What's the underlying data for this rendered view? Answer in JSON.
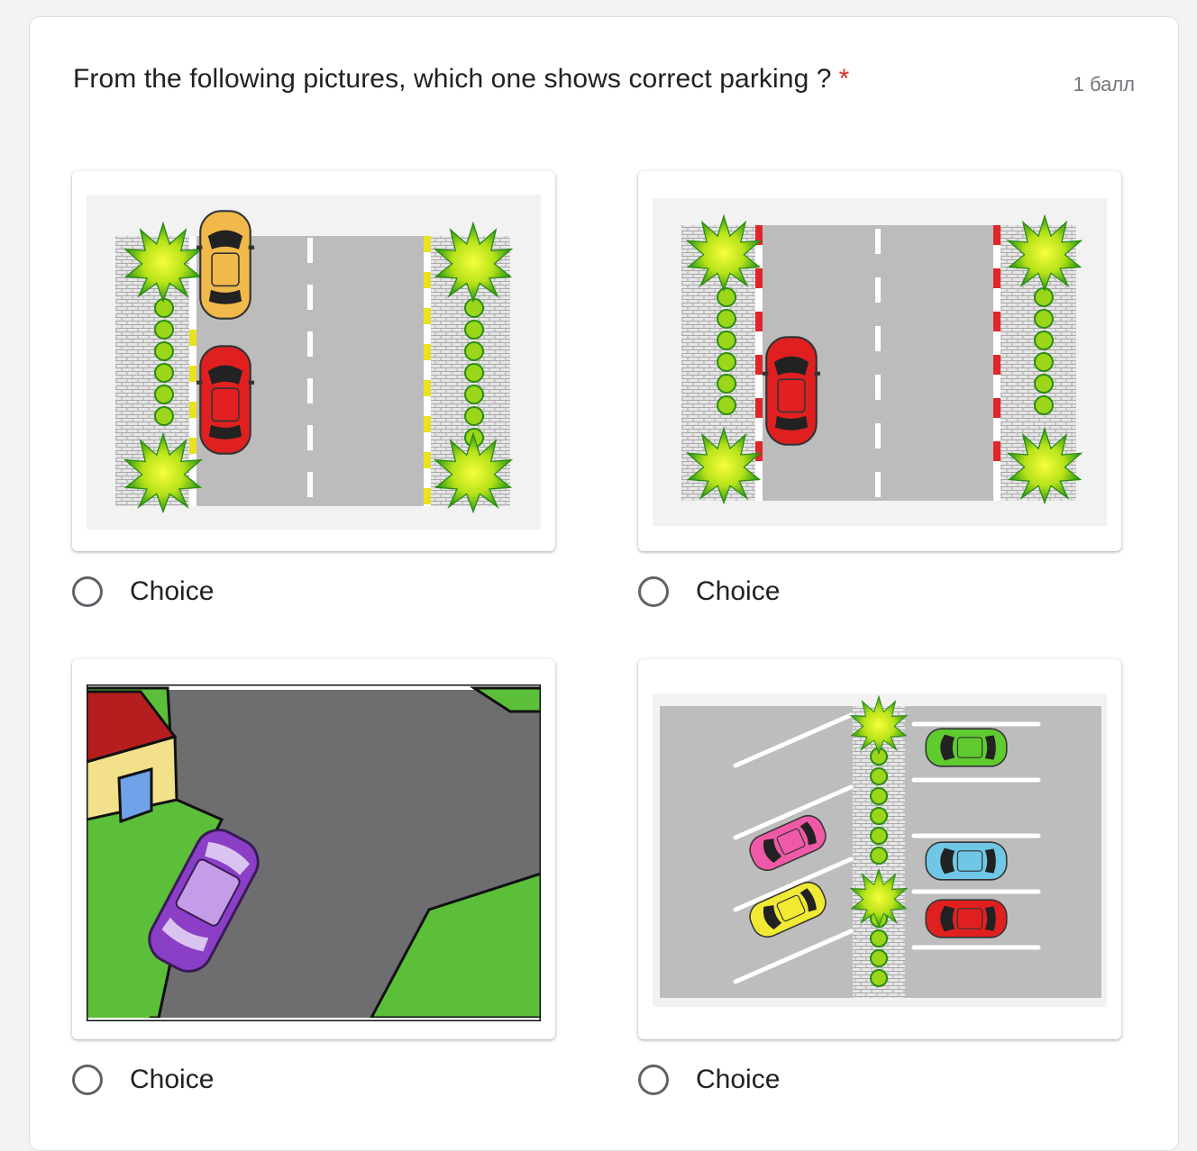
{
  "question": {
    "title": "From the following pictures, which one shows correct parking ?",
    "required_mark": "*",
    "points": "1 балл"
  },
  "options": [
    {
      "label": "Choice",
      "picture": "parallel-parking-yellow-curb"
    },
    {
      "label": "Choice",
      "picture": "parking-red-white-curb"
    },
    {
      "label": "Choice",
      "picture": "purple-car-at-house-corner"
    },
    {
      "label": "Choice",
      "picture": "angled-and-perpendicular-lot"
    }
  ],
  "colors": {
    "required": "#d93025",
    "radio_border": "#5f6368",
    "text": "#202124"
  }
}
